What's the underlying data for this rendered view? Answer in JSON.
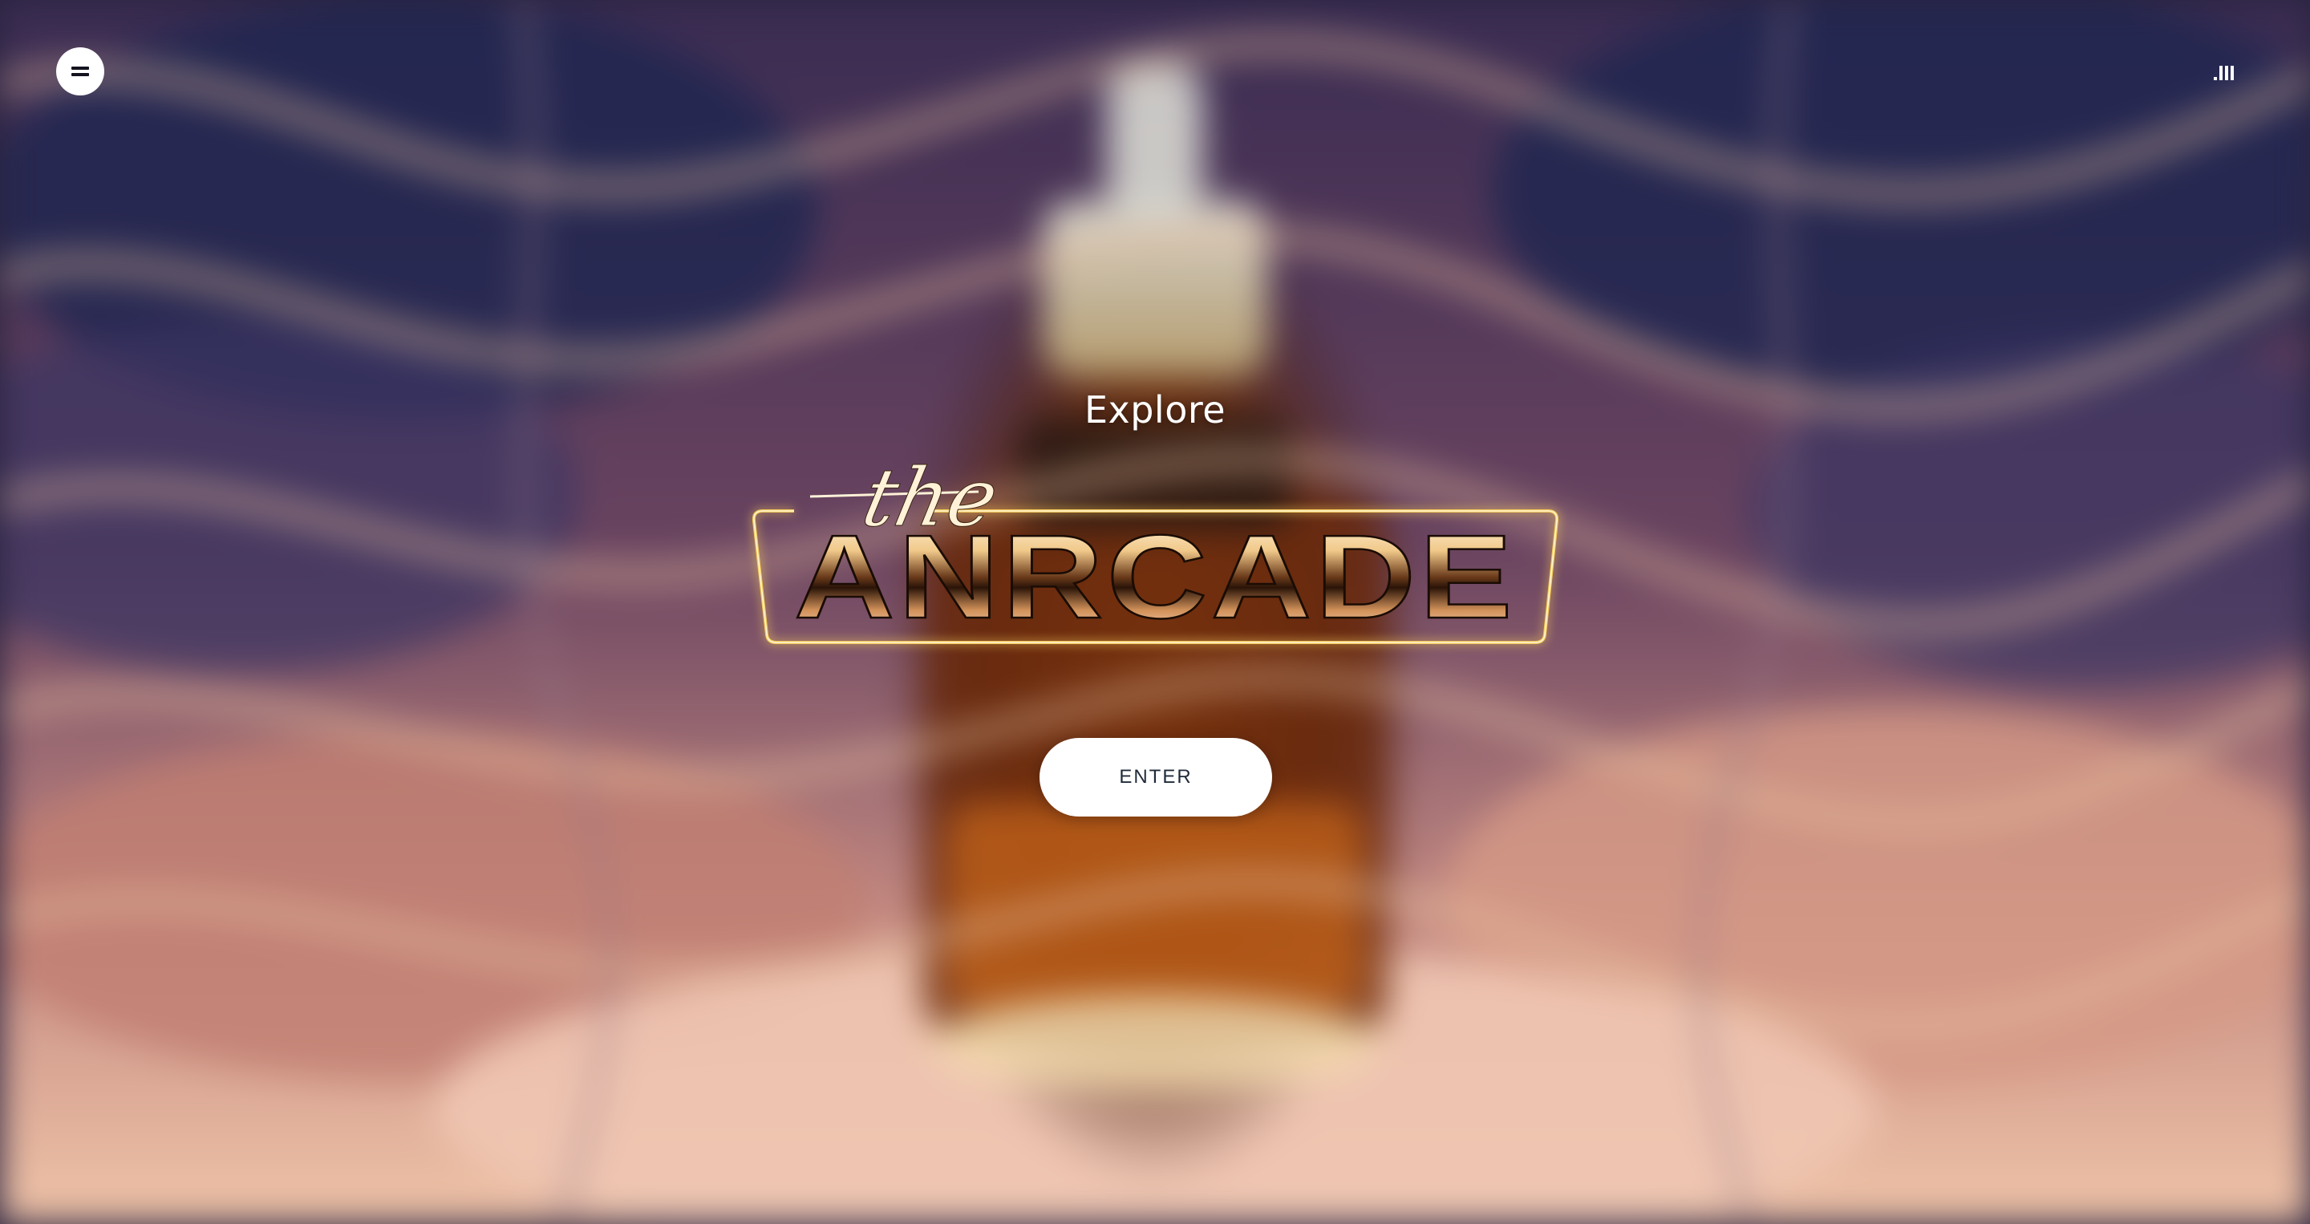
{
  "header": {
    "menu_icon": "hamburger-menu-icon",
    "sound_icon": "sound-bars-icon",
    "sound_label": ".Ill"
  },
  "hero": {
    "title": "Explore",
    "logo_script": "the",
    "logo_word": "ANRCADE",
    "enter_label": "ENTER"
  },
  "colors": {
    "logo_frame": "#f3c85a",
    "button_bg": "#ffffff",
    "button_text": "#1f2a3a",
    "background_dark": "#2a2440",
    "background_amber": "#8a4a18",
    "background_peach": "#e8b29a"
  }
}
